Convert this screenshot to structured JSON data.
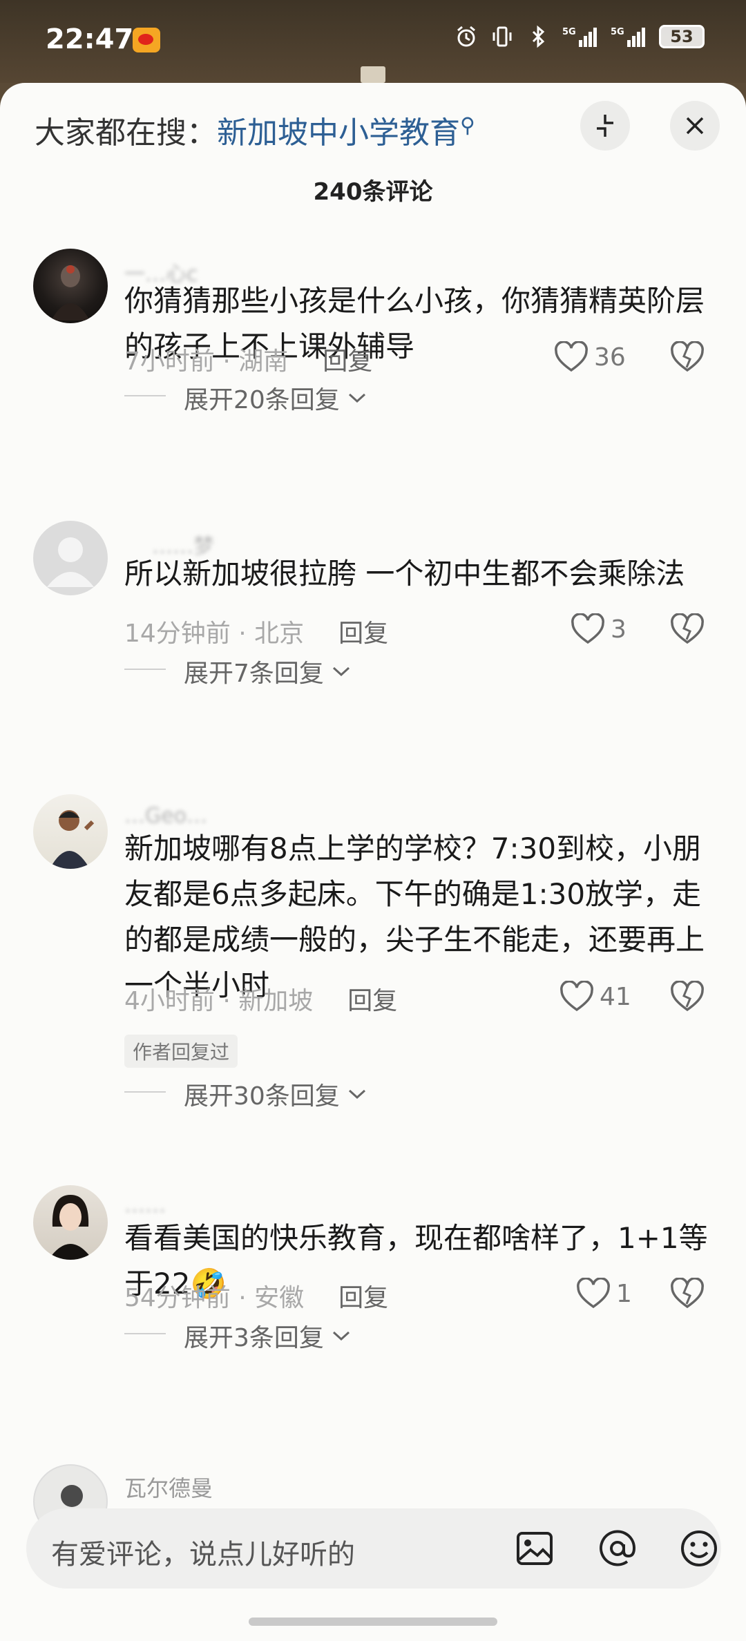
{
  "status_bar": {
    "time": "22:47",
    "network_1": "5G",
    "network_2": "5G",
    "battery": "53"
  },
  "header": {
    "search_prefix": "大家都在搜：",
    "search_keyword": "新加坡中小学教育",
    "comment_count": "240条评论"
  },
  "comments": [
    {
      "username": "一…心c",
      "text": "你猜猜那些小孩是什么小孩，你猜猜精英阶层的孩子上不上课外辅导",
      "time": "7小时前",
      "location": "湖南",
      "reply_label": "回复",
      "likes": "36",
      "expand": "展开20条回复",
      "avatar_icon": "dark-portrait-avatar"
    },
    {
      "username": "……梦",
      "text": "所以新加坡很拉胯  一个初中生都不会乘除法",
      "time": "14分钟前",
      "location": "北京",
      "reply_label": "回复",
      "likes": "3",
      "expand": "展开7条回复",
      "avatar_icon": "default-person-avatar"
    },
    {
      "username": "…Geo…",
      "text": "新加坡哪有8点上学的学校？7:30到校，小朋友都是6点多起床。下午的确是1:30放学，走的都是成绩一般的，尖子生不能走，还要再上一个半小时",
      "time": "4小时前",
      "location": "新加坡",
      "reply_label": "回复",
      "likes": "41",
      "badge": "作者回复过",
      "expand": "展开30条回复",
      "avatar_icon": "child-photo-avatar"
    },
    {
      "username": "……",
      "text": "看看美国的快乐教育，现在都啥样了，1+1等于22🤣",
      "time": "54分钟前",
      "location": "安徽",
      "reply_label": "回复",
      "likes": "1",
      "expand": "展开3条回复",
      "avatar_icon": "woman-photo-avatar"
    },
    {
      "username": "瓦尔德曼",
      "avatar_icon": "partial-avatar"
    }
  ],
  "input": {
    "placeholder": "有爱评论，说点儿好听的",
    "icons": [
      "image-icon",
      "at-icon",
      "emoji-icon"
    ]
  },
  "colors": {
    "keyword": "#2d5f94",
    "sheet_bg": "#fbfbf9",
    "meta": "#a8a8a8"
  }
}
